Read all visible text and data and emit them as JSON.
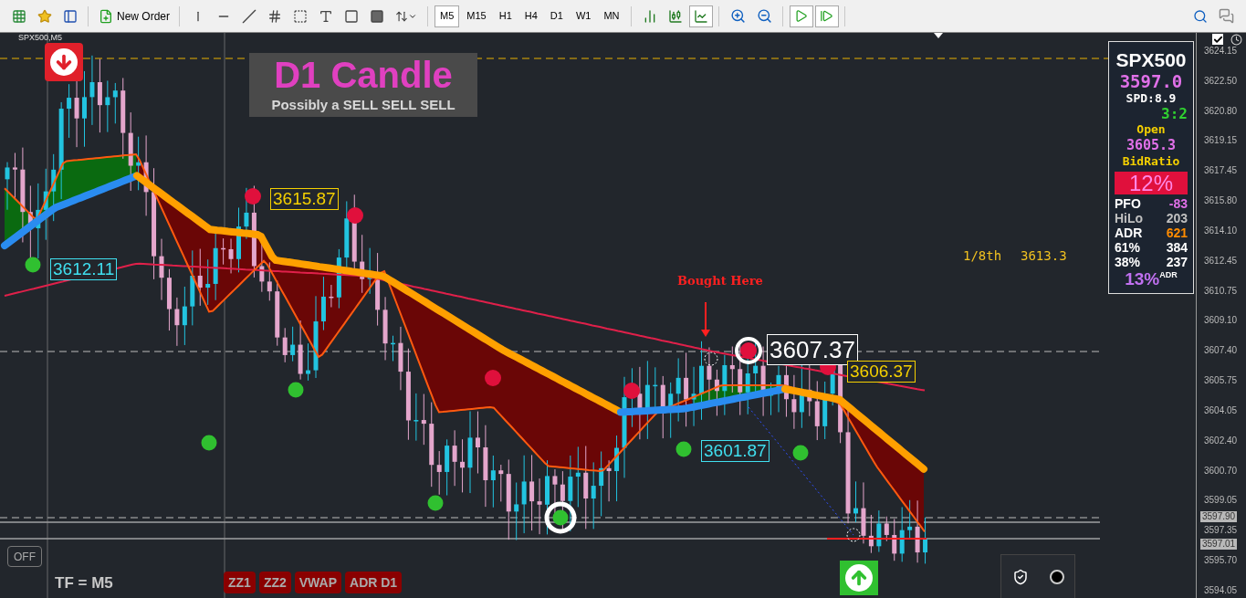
{
  "toolbar": {
    "new_order": "New Order",
    "timeframes": [
      {
        "label": "M5",
        "selected": true
      },
      {
        "label": "M15",
        "selected": false
      },
      {
        "label": "H1",
        "selected": false
      },
      {
        "label": "H4",
        "selected": false
      },
      {
        "label": "D1",
        "selected": false
      },
      {
        "label": "W1",
        "selected": false
      },
      {
        "label": "MN",
        "selected": false
      }
    ],
    "chart_modes": [
      {
        "kind": "bars",
        "selected": false
      },
      {
        "kind": "candles",
        "selected": false
      },
      {
        "kind": "line",
        "selected": true
      }
    ],
    "navigation": [
      {
        "kind": "autoscroll",
        "selected": true
      },
      {
        "kind": "shift",
        "selected": true
      }
    ]
  },
  "chart": {
    "symbol": "SPX500,M5",
    "banner": {
      "title": "D1 Candle",
      "subtitle": "Possibly a SELL SELL SELL"
    },
    "price_labels": [
      {
        "text": "3615.87",
        "kind": "box",
        "color": "#f5d000"
      },
      {
        "text": "3612.11",
        "kind": "box",
        "color": "#40e0f0"
      },
      {
        "text": "3607.37",
        "kind": "large",
        "color": "#ffffff"
      },
      {
        "text": "3606.37",
        "kind": "box",
        "color": "#f5d000"
      },
      {
        "text": "3601.87",
        "kind": "box",
        "color": "#40e0f0"
      }
    ],
    "annotation": "Bought Here",
    "eighth": {
      "label": "1/8th",
      "value": "3613.3"
    },
    "autotrade_checked": true,
    "off_button": "OFF",
    "timeframe_label": "TF = M5",
    "indicator_buttons": [
      "ZZ1",
      "ZZ2",
      "VWAP",
      "ADR D1"
    ]
  },
  "info_panel": {
    "symbol": "SPX500",
    "price": "3597.0",
    "spread": "SPD:8.9",
    "ratio": "3:2",
    "open_label": "Open",
    "open_value": "3605.3",
    "bid_label": "BidRatio",
    "bid_value": "12%",
    "stats": [
      {
        "label": "PFO",
        "value": "-83",
        "dimmed": false,
        "color": "#e070e8"
      },
      {
        "label": "HiLo",
        "value": "203",
        "dimmed": true,
        "color": "#c0c0c0"
      },
      {
        "label": "ADR",
        "value": "621",
        "dimmed": false,
        "color": "#ff8c00"
      },
      {
        "label": "61%",
        "value": "384",
        "dimmed": false,
        "color": "#ffffff"
      },
      {
        "label": "38%",
        "value": "237",
        "dimmed": false,
        "color": "#ffffff"
      }
    ],
    "adr_percent": "13%",
    "adr_suffix": "ADR"
  },
  "price_axis": {
    "ticks": [
      "3624.15",
      "3622.50",
      "3620.80",
      "3619.15",
      "3617.45",
      "3615.80",
      "3614.10",
      "3612.45",
      "3610.75",
      "3609.10",
      "3607.40",
      "3605.75",
      "3604.05",
      "3602.40",
      "3600.70",
      "3599.05",
      "3597.35",
      "3595.70",
      "3594.05"
    ],
    "markers": [
      {
        "text": "3597.90"
      },
      {
        "text": "3597.01"
      }
    ]
  }
}
